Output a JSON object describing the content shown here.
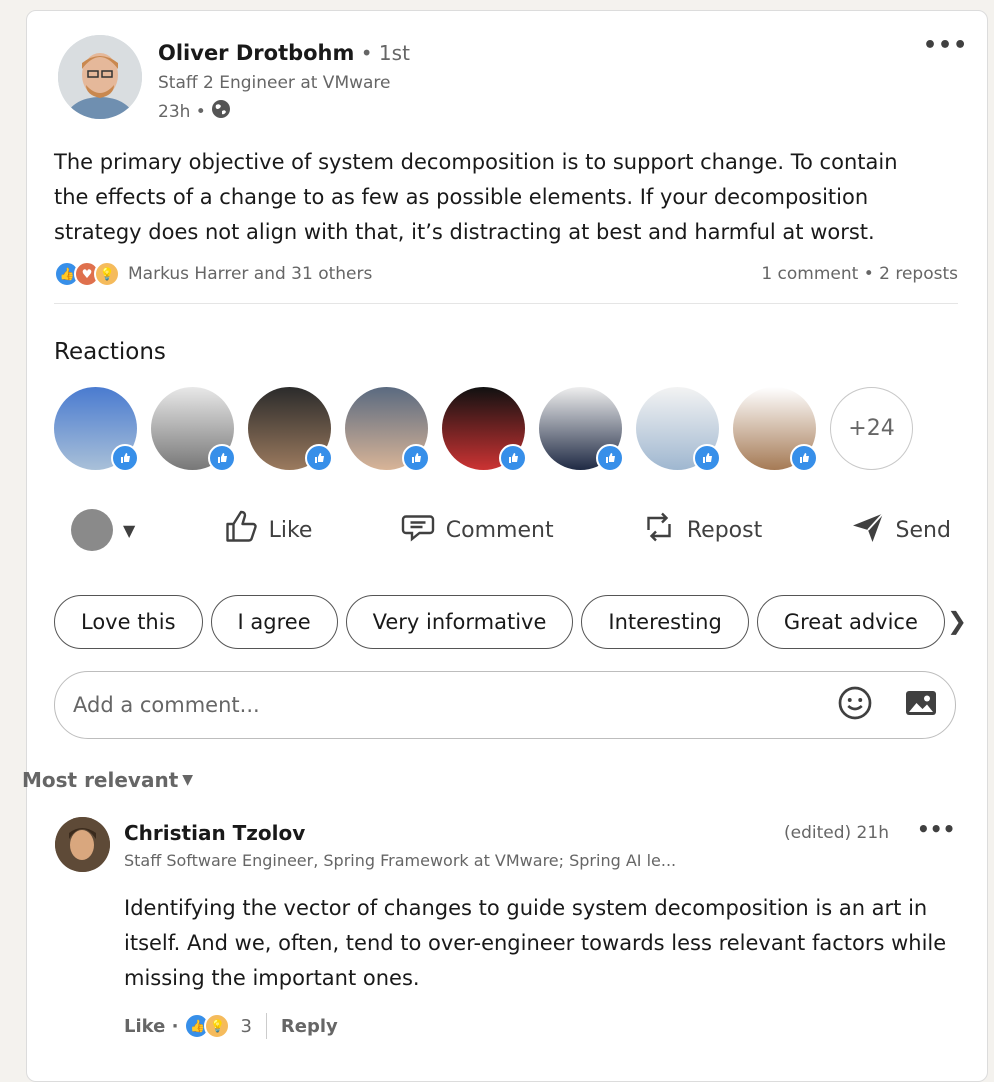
{
  "post": {
    "author_name": "Oliver Drotbohm",
    "connection_degree": " • 1st",
    "author_title": "Staff 2 Engineer at VMware",
    "time": "23h •",
    "visibility_icon": "globe-icon",
    "text": "The primary objective of system decomposition is to support change. To contain the effects of a change to as few as possible elements. If your decomposition strategy does not align with that, it’s distracting at best and harmful at worst.",
    "reactions_summary": "Markus Harrer and 31 others",
    "comments_reposts": "1 comment • 2 reposts"
  },
  "reactions_section": {
    "title": "Reactions",
    "more_count": "+24"
  },
  "actions": {
    "like": "Like",
    "comment": "Comment",
    "repost": "Repost",
    "send": "Send"
  },
  "quick_replies": [
    "Love this",
    "I agree",
    "Very informative",
    "Interesting",
    "Great advice"
  ],
  "comment_input": {
    "placeholder": "Add a comment..."
  },
  "sort": {
    "label": "Most relevant"
  },
  "comment": {
    "author_name": "Christian Tzolov",
    "author_title": "Staff Software Engineer, Spring Framework at VMware; Spring AI le...",
    "time": "(edited) 21h",
    "text": "Identifying the vector of changes to guide system decomposition is an art in itself. And we, often, tend to over-engineer towards less relevant factors while missing the important ones.",
    "like_label": "Like ·",
    "reaction_count": "3",
    "reply_label": "Reply"
  },
  "colors": {
    "like_blue": "#378fe9",
    "love_red": "#df704d",
    "insight_yellow": "#f5bb5c"
  }
}
